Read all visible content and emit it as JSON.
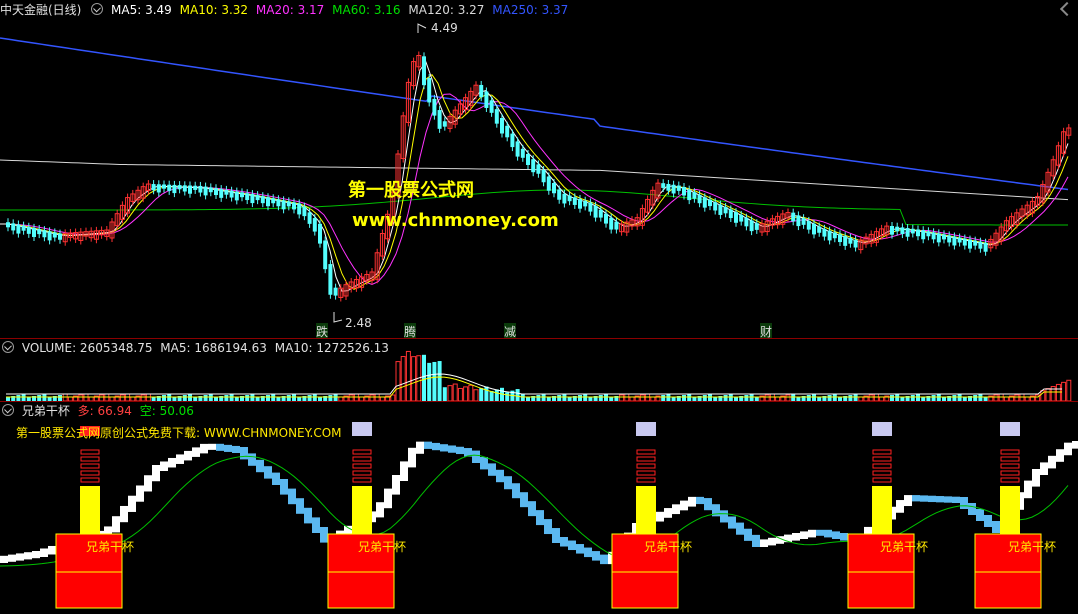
{
  "main_chart": {
    "stock_name": "中天金融(日线)",
    "indicators": [
      {
        "name": "MA5",
        "label": "MA5: 3.49",
        "color": "#ffffff"
      },
      {
        "name": "MA10",
        "label": "MA10: 3.32",
        "color": "#ffff00"
      },
      {
        "name": "MA20",
        "label": "MA20: 3.17",
        "color": "#ff33ff"
      },
      {
        "name": "MA60",
        "label": "MA60: 3.16",
        "color": "#00e000"
      },
      {
        "name": "MA120",
        "label": "MA120: 3.27",
        "color": "#d8d8d8"
      },
      {
        "name": "MA250",
        "label": "MA250: 3.37",
        "color": "#3355ff"
      }
    ],
    "high_label": "4.49",
    "low_label": "2.48",
    "event_markers": [
      "跌",
      "腾",
      "减",
      "财"
    ],
    "watermark_title": "第一股票公式网",
    "watermark_url": "www.chnmoney.com"
  },
  "volume_panel": {
    "label_volume": "VOLUME: 2605348.75",
    "label_ma5": "MA5: 1686194.63",
    "label_ma10": "MA10: 1272526.13"
  },
  "indicator_panel": {
    "name": "兄弟干杯",
    "long_label": "多: 66.94",
    "short_label": "空: 50.06",
    "promo_text": "第一股票公式网原创公式免费下载: WWW.CHNMONEY.COM",
    "box_label": "兄弟干杯"
  },
  "colors": {
    "up": "#ff3232",
    "down": "#54ffff",
    "border": "#8b0000",
    "box": "#ff0000",
    "bar": "#ffff00",
    "step_up": "#ffffff",
    "step_down": "#5bb8f0"
  }
}
